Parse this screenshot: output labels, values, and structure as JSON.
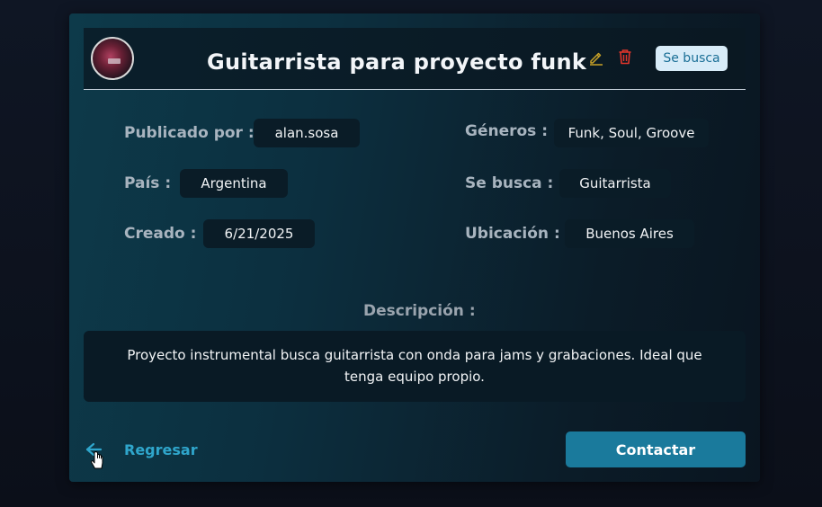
{
  "post": {
    "title": "Guitarrista para proyecto funk",
    "status_badge": "Se busca"
  },
  "details": {
    "publicado_por": {
      "label": "Publicado por :",
      "value": "alan.sosa"
    },
    "pais": {
      "label": "País :",
      "value": "Argentina"
    },
    "creado": {
      "label": "Creado :",
      "value": "6/21/2025"
    },
    "generos": {
      "label": "Géneros :",
      "value": "Funk, Soul, Groove"
    },
    "se_busca": {
      "label": "Se busca :",
      "value": "Guitarrista"
    },
    "ubicacion": {
      "label": "Ubicación :",
      "value": "Buenos Aires"
    }
  },
  "description": {
    "label": "Descripción :",
    "text": "Proyecto instrumental busca guitarrista con onda para jams y grabaciones. Ideal que tenga equipo propio."
  },
  "actions": {
    "back_label": "Regresar",
    "contact_label": "Contactar"
  },
  "icons": {
    "edit": "pencil-icon",
    "delete": "trash-icon",
    "back": "arrow-left-icon"
  },
  "colors": {
    "accent": "#1a7a9c",
    "link": "#2fa6cc",
    "edit_icon": "#c9a227",
    "delete_icon": "#e0352b",
    "badge_bg": "#d8ecf8",
    "badge_text": "#1a6f96"
  }
}
